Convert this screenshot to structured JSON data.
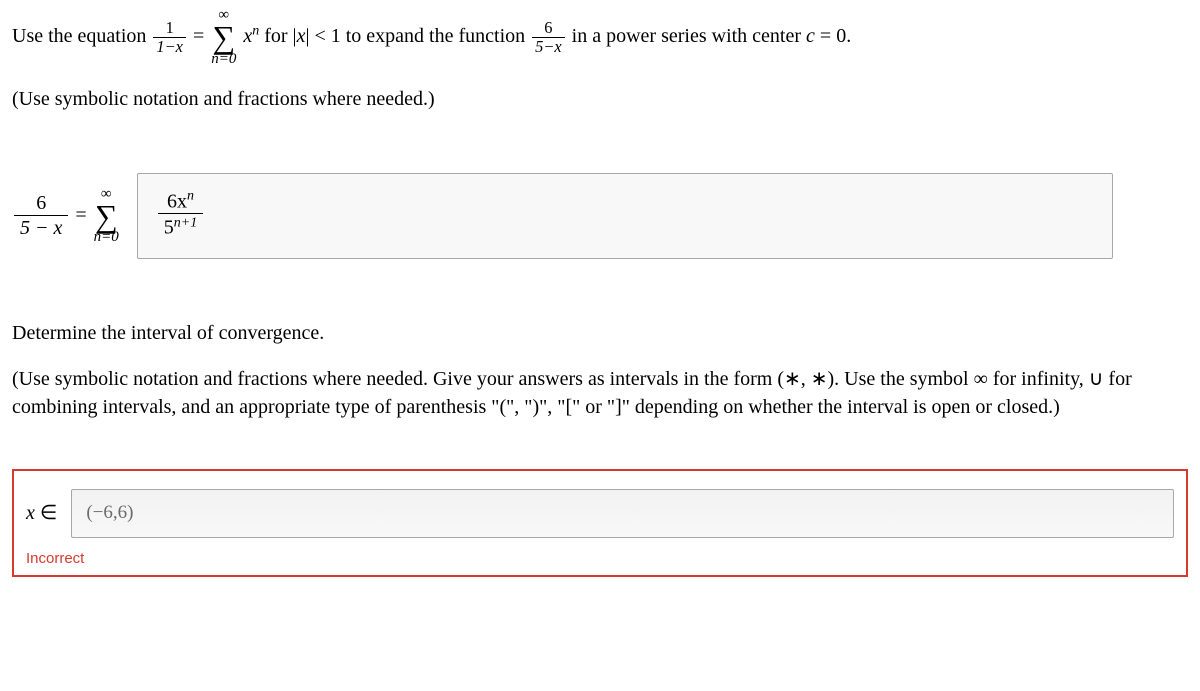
{
  "q1": {
    "pre": "Use the equation ",
    "frac1_num": "1",
    "frac1_den": "1−x",
    "eq": " = ",
    "sum_top": "∞",
    "sum_bot": "n=0",
    "xpow": "x",
    "xpow_exp": "n",
    "mid1": " for |",
    "absvar": "x",
    "mid2": "| < 1 to expand the function ",
    "frac2_num": "6",
    "frac2_den": "5−x",
    "mid3": " in a power series with center ",
    "cvar": "c",
    "tail": " = 0."
  },
  "q1_hint": "(Use symbolic notation and fractions where needed.)",
  "ans1": {
    "lhs_num": "6",
    "lhs_den": "5 − x",
    "eq": " = ",
    "sum_top": "∞",
    "sum_bot": "n=0",
    "term_num_a": "6x",
    "term_num_exp": "n",
    "term_den_a": "5",
    "term_den_exp": "n+1"
  },
  "q2_line1": "Determine the interval of convergence.",
  "q2_hint": "(Use symbolic notation and fractions where needed. Give your answers as intervals in the form (∗, ∗). Use the symbol ∞ for infinity, ∪ for combining intervals, and an appropriate type of parenthesis \"(\", \")\", \"[\" or \"]\" depending on whether the interval is open or closed.)",
  "ans2": {
    "label_var": "x",
    "label_in": " ∈",
    "value": "(−6,6)"
  },
  "feedback": "Incorrect"
}
